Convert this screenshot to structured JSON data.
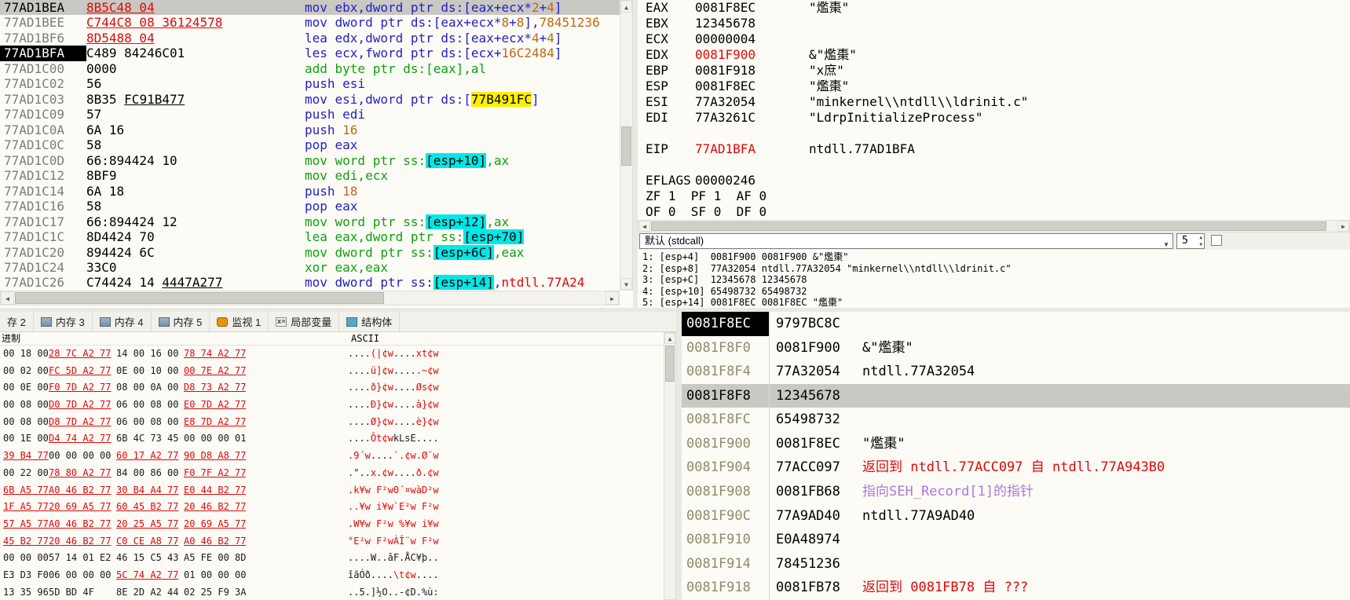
{
  "colors": {
    "accent_red": "#DC0A0A",
    "accent_green": "#0FA00F",
    "accent_blue": "#2121C8",
    "accent_orange": "#C06818",
    "highlight_cyan": "#00E8E8",
    "highlight_yellow": "#FFF000",
    "seh_purple": "#AA78DC",
    "selection_gray": "#C9C8C2"
  },
  "disasm": {
    "rows": [
      {
        "addr": "77AD1BEA",
        "sel": true,
        "bytes": [
          [
            "8B5C48 04",
            "rd ul"
          ]
        ],
        "ins": [
          [
            "mov ebx,dword ptr ds:[eax+ecx*",
            "mb"
          ],
          [
            "2",
            "or"
          ],
          [
            "+",
            "mb"
          ],
          [
            "4",
            "or"
          ],
          [
            "]",
            "mb"
          ]
        ]
      },
      {
        "addr": "77AD1BEE",
        "bytes": [
          [
            "C744C8 08 36124578",
            "rd ul"
          ]
        ],
        "ins": [
          [
            "mov dword ptr ds:[eax+ecx*",
            "mb"
          ],
          [
            "8",
            "or"
          ],
          [
            "+",
            "mb"
          ],
          [
            "8",
            "or"
          ],
          [
            "],",
            "mb"
          ],
          [
            "78451236",
            "or"
          ]
        ]
      },
      {
        "addr": "77AD1BF6",
        "bytes": [
          [
            "8D5488 04",
            "rd ul"
          ]
        ],
        "ins": [
          [
            "lea edx,dword ptr ds:[eax+ecx*",
            "mb"
          ],
          [
            "4",
            "or"
          ],
          [
            "+",
            "mb"
          ],
          [
            "4",
            "or"
          ],
          [
            "]",
            "mb"
          ]
        ]
      },
      {
        "addr": "77AD1BFA",
        "eip": true,
        "bytes": [
          [
            "C489 84246C01",
            "k"
          ]
        ],
        "ins": [
          [
            "les ecx,fword ptr ds:[ecx+",
            "mb"
          ],
          [
            "16C2484",
            "or"
          ],
          [
            "]",
            "mb"
          ]
        ]
      },
      {
        "addr": "77AD1C00",
        "bytes": [
          [
            "0000",
            "k"
          ]
        ],
        "ins": [
          [
            "add byte ptr ds:[eax],al",
            "gr"
          ]
        ]
      },
      {
        "addr": "77AD1C02",
        "bytes": [
          [
            "56",
            "k"
          ]
        ],
        "ins": [
          [
            "push esi",
            "mb"
          ]
        ]
      },
      {
        "addr": "77AD1C03",
        "bytes": [
          [
            "8B35 ",
            "k"
          ],
          [
            "FC91B477",
            "k ul"
          ]
        ],
        "ins": [
          [
            "mov esi,dword ptr ds:[",
            "mb"
          ],
          [
            "77B491FC",
            "hy"
          ],
          [
            "]",
            "mb"
          ]
        ]
      },
      {
        "addr": "77AD1C09",
        "bytes": [
          [
            "57",
            "k"
          ]
        ],
        "ins": [
          [
            "push edi",
            "mb"
          ]
        ]
      },
      {
        "addr": "77AD1C0A",
        "bytes": [
          [
            "6A 16",
            "k"
          ]
        ],
        "ins": [
          [
            "push ",
            "mb"
          ],
          [
            "16",
            "or"
          ]
        ]
      },
      {
        "addr": "77AD1C0C",
        "bytes": [
          [
            "58",
            "k"
          ]
        ],
        "ins": [
          [
            "pop eax",
            "mb"
          ]
        ]
      },
      {
        "addr": "77AD1C0D",
        "bytes": [
          [
            "66:894424 10",
            "k"
          ]
        ],
        "ins": [
          [
            "mov word ptr ss:",
            "gr"
          ],
          [
            "[esp+10]",
            "hc"
          ],
          [
            ",ax",
            "gr"
          ]
        ]
      },
      {
        "addr": "77AD1C12",
        "bytes": [
          [
            "8BF9",
            "k"
          ]
        ],
        "ins": [
          [
            "mov edi,ecx",
            "gr"
          ]
        ]
      },
      {
        "addr": "77AD1C14",
        "bytes": [
          [
            "6A 18",
            "k"
          ]
        ],
        "ins": [
          [
            "push ",
            "mb"
          ],
          [
            "18",
            "or"
          ]
        ]
      },
      {
        "addr": "77AD1C16",
        "bytes": [
          [
            "58",
            "k"
          ]
        ],
        "ins": [
          [
            "pop eax",
            "mb"
          ]
        ]
      },
      {
        "addr": "77AD1C17",
        "bytes": [
          [
            "66:894424 12",
            "k"
          ]
        ],
        "ins": [
          [
            "mov word ptr ss:",
            "gr"
          ],
          [
            "[esp+12]",
            "hc"
          ],
          [
            ",ax",
            "gr"
          ]
        ]
      },
      {
        "addr": "77AD1C1C",
        "bytes": [
          [
            "8D4424 70",
            "k"
          ]
        ],
        "ins": [
          [
            "lea eax,dword ptr ss:",
            "gr"
          ],
          [
            "[esp+70]",
            "hc"
          ]
        ]
      },
      {
        "addr": "77AD1C20",
        "bytes": [
          [
            "894424 6C",
            "k"
          ]
        ],
        "ins": [
          [
            "mov dword ptr ss:",
            "gr"
          ],
          [
            "[esp+6C]",
            "hc"
          ],
          [
            ",eax",
            "gr"
          ]
        ]
      },
      {
        "addr": "77AD1C24",
        "bytes": [
          [
            "33C0",
            "k"
          ]
        ],
        "ins": [
          [
            "xor eax,eax",
            "gr"
          ]
        ]
      },
      {
        "addr": "77AD1C26",
        "bytes": [
          [
            "C74424 14 ",
            "k"
          ],
          [
            "4447A277",
            "k ul"
          ]
        ],
        "ins": [
          [
            "mov dword ptr ss:",
            "mb"
          ],
          [
            "[esp+14]",
            "hc"
          ],
          [
            ",",
            "mb"
          ],
          [
            "ntdll.77A24",
            "rd"
          ]
        ]
      }
    ]
  },
  "registers": {
    "rows": [
      {
        "n": "EAX",
        "v": "0081F8EC",
        "x": "\"爁棗\""
      },
      {
        "n": "EBX",
        "v": "12345678",
        "x": ""
      },
      {
        "n": "ECX",
        "v": "00000004",
        "x": ""
      },
      {
        "n": "EDX",
        "v": "0081F900",
        "vc": "rd",
        "x": "&\"爁棗\""
      },
      {
        "n": "EBP",
        "v": "0081F918",
        "x": "\"x庶\""
      },
      {
        "n": "ESP",
        "v": "0081F8EC",
        "x": "\"爁棗\""
      },
      {
        "n": "ESI",
        "v": "77A32054",
        "x": "\"minkernel\\\\ntdll\\\\ldrinit.c\""
      },
      {
        "n": "EDI",
        "v": "77A3261C",
        "x": "\"LdrpInitializeProcess\""
      },
      {
        "n": "",
        "v": "",
        "x": ""
      },
      {
        "n": "EIP",
        "v": "77AD1BFA",
        "vc": "rd",
        "x": "ntdll.77AD1BFA"
      },
      {
        "n": "",
        "v": "",
        "x": ""
      },
      {
        "n": "EFLAGS",
        "v": "00000246",
        "x": ""
      },
      {
        "n": "ZF 1  PF 1  AF 0",
        "v": "",
        "x": ""
      },
      {
        "n": "OF 0  SF 0  DF 0",
        "v": "",
        "x": ""
      }
    ]
  },
  "callconv": {
    "label": "默认 (stdcall)",
    "spin": "5",
    "dropdown_arrow": "▼"
  },
  "args": {
    "lines": [
      "1: [esp+4]  0081F900 0081F900 &\"爁棗\"",
      "2: [esp+8]  77A32054 ntdll.77A32054 \"minkernel\\\\ntdll\\\\ldrinit.c\"",
      "3: [esp+C]  12345678 12345678",
      "4: [esp+10] 65498732 65498732",
      "5: [esp+14] 0081F8EC 0081F8EC \"爁棗\""
    ]
  },
  "tabs": [
    {
      "label": "存 2",
      "icon": ""
    },
    {
      "label": "内存 3",
      "icon": "memory-icon"
    },
    {
      "label": "内存 4",
      "icon": "memory-icon"
    },
    {
      "label": "内存 5",
      "icon": "memory-icon"
    },
    {
      "label": "监视 1",
      "icon": "watch-icon"
    },
    {
      "label": "局部变量",
      "icon": "locals-icon"
    },
    {
      "label": "结构体",
      "icon": "struct-icon"
    }
  ],
  "dump": {
    "header_left": "进制",
    "header_ascii": "ASCII",
    "rows": [
      {
        "hex": [
          [
            "00 18 00",
            "k"
          ],
          [
            "28 7C A2 77",
            "rd hexul"
          ],
          [
            "14 00 16 00",
            "k"
          ],
          [
            "78 74 A2 77",
            "rd hexul"
          ]
        ],
        "ascii": [
          [
            "....",
            "k"
          ],
          [
            "(|¢w",
            "rd"
          ],
          [
            "....",
            "k"
          ],
          [
            "xt¢w",
            "rd"
          ]
        ]
      },
      {
        "hex": [
          [
            "00 02 00",
            "k"
          ],
          [
            "FC 5D A2 77",
            "rd hexul"
          ],
          [
            "0E 00 10 00",
            "k"
          ],
          [
            "00 7E A2 77",
            "rd hexul"
          ]
        ],
        "ascii": [
          [
            "....",
            "k"
          ],
          [
            "ü]¢w",
            "rd"
          ],
          [
            "....",
            "k"
          ],
          [
            ".~¢w",
            "rd"
          ]
        ]
      },
      {
        "hex": [
          [
            "00 0E 00",
            "k"
          ],
          [
            "F0 7D A2 77",
            "rd hexul"
          ],
          [
            "08 00 0A 00",
            "k"
          ],
          [
            "D8 73 A2 77",
            "rd hexul"
          ]
        ],
        "ascii": [
          [
            "....",
            "k"
          ],
          [
            "ð}¢w",
            "rd"
          ],
          [
            "....",
            "k"
          ],
          [
            "Øs¢w",
            "rd"
          ]
        ]
      },
      {
        "hex": [
          [
            "00 08 00",
            "k"
          ],
          [
            "D0 7D A2 77",
            "rd hexul"
          ],
          [
            "06 00 08 00",
            "k"
          ],
          [
            "E0 7D A2 77",
            "rd hexul"
          ]
        ],
        "ascii": [
          [
            "....",
            "k"
          ],
          [
            "Ð}¢w",
            "rd"
          ],
          [
            "....",
            "k"
          ],
          [
            "à}¢w",
            "rd"
          ]
        ]
      },
      {
        "hex": [
          [
            "00 08 00",
            "k"
          ],
          [
            "D8 7D A2 77",
            "rd hexul"
          ],
          [
            "06 00 08 00",
            "k"
          ],
          [
            "E8 7D A2 77",
            "rd hexul"
          ]
        ],
        "ascii": [
          [
            "....",
            "k"
          ],
          [
            "Ø}¢w",
            "rd"
          ],
          [
            "....",
            "k"
          ],
          [
            "è}¢w",
            "rd"
          ]
        ]
      },
      {
        "hex": [
          [
            "00 1E 00",
            "k"
          ],
          [
            "D4 74 A2 77",
            "rd hexul"
          ],
          [
            "6B 4C 73 45",
            "k"
          ],
          [
            "00 00 00 01",
            "k"
          ]
        ],
        "ascii": [
          [
            "....",
            "k"
          ],
          [
            "Ôt¢w",
            "rd"
          ],
          [
            "kLsE",
            "k"
          ],
          [
            "....",
            "k"
          ]
        ]
      },
      {
        "hex": [
          [
            "39 B4 77",
            "rd hexul"
          ],
          [
            "00 00 00 00",
            "k"
          ],
          [
            "60 17 A2 77",
            "rd hexul"
          ],
          [
            "90 D8 A8 77",
            "rd hexul"
          ]
        ],
        "ascii": [
          [
            ".9´w",
            "rd"
          ],
          [
            "....",
            "k"
          ],
          [
            "`.¢w",
            "rd"
          ],
          [
            ".Ø¨w",
            "rd"
          ]
        ]
      },
      {
        "hex": [
          [
            "00 22 00",
            "k"
          ],
          [
            "78 80 A2 77",
            "rd hexul"
          ],
          [
            "84 00 86 00",
            "k"
          ],
          [
            "F0 7F A2 77",
            "rd hexul"
          ]
        ],
        "ascii": [
          [
            ".\"..",
            "k"
          ],
          [
            "x.¢w",
            "rd"
          ],
          [
            "....",
            "k"
          ],
          [
            "ð.¢w",
            "rd"
          ]
        ]
      },
      {
        "hex": [
          [
            "6B A5 77",
            "rd hexul"
          ],
          [
            "A0 46 B2 77",
            "rd hexul"
          ],
          [
            "30 B4 A4 77",
            "rd hexul"
          ],
          [
            "E0 44 B2 77",
            "rd hexul"
          ]
        ],
        "ascii": [
          [
            ".k¥w",
            "rd"
          ],
          [
            " F²w",
            "rd"
          ],
          [
            "0´¤w",
            "rd"
          ],
          [
            "àD²w",
            "rd"
          ]
        ]
      },
      {
        "hex": [
          [
            "1F A5 77",
            "rd hexul"
          ],
          [
            "20 69 A5 77",
            "rd hexul"
          ],
          [
            "60 45 B2 77",
            "rd hexul"
          ],
          [
            "20 46 B2 77",
            "rd hexul"
          ]
        ],
        "ascii": [
          [
            "..¥w",
            "rd"
          ],
          [
            " i¥w",
            "rd"
          ],
          [
            "`E²w",
            "rd"
          ],
          [
            " F²w",
            "rd"
          ]
        ]
      },
      {
        "hex": [
          [
            "57 A5 77",
            "rd hexul"
          ],
          [
            "A0 46 B2 77",
            "rd hexul"
          ],
          [
            "20 25 A5 77",
            "rd hexul"
          ],
          [
            "20 69 A5 77",
            "rd hexul"
          ]
        ],
        "ascii": [
          [
            ".W¥w",
            "rd"
          ],
          [
            " F²w",
            "rd"
          ],
          [
            " %¥w",
            "rd"
          ],
          [
            " i¥w",
            "rd"
          ]
        ]
      },
      {
        "hex": [
          [
            "45 B2 77",
            "rd hexul"
          ],
          [
            "20 46 B2 77",
            "rd hexul"
          ],
          [
            "C0 CE A8 77",
            "rd hexul"
          ],
          [
            "A0 46 B2 77",
            "rd hexul"
          ]
        ],
        "ascii": [
          [
            "°E²w",
            "rd"
          ],
          [
            " F²w",
            "rd"
          ],
          [
            "ÀÎ¨w",
            "rd"
          ],
          [
            " F²w",
            "rd"
          ]
        ]
      },
      {
        "hex": [
          [
            "00 00 00",
            "k"
          ],
          [
            "57 14 01 E2",
            "k"
          ],
          [
            "46 15 C5 43",
            "k"
          ],
          [
            "A5 FE 00 8D",
            "k"
          ]
        ],
        "ascii": [
          [
            "....",
            "k"
          ],
          [
            "W..â",
            "k"
          ],
          [
            "F.ÅC",
            "k"
          ],
          [
            "¥þ..",
            "k"
          ]
        ]
      },
      {
        "hex": [
          [
            "E3 D3 F0",
            "k"
          ],
          [
            "06 00 00 00",
            "k"
          ],
          [
            "5C 74 A2 77",
            "rd hexul"
          ],
          [
            "01 00 00 00",
            "k"
          ]
        ],
        "ascii": [
          [
            "îãÓð",
            "k"
          ],
          [
            "....",
            "k"
          ],
          [
            "\\t¢w",
            "rd"
          ],
          [
            "....",
            "k"
          ]
        ]
      },
      {
        "hex": [
          [
            "13 35 96",
            "k"
          ],
          [
            "5D BD 4F",
            "k"
          ],
          [
            "8E 2D A2 44",
            "k"
          ],
          [
            "02 25 F9 3A",
            "k"
          ]
        ],
        "ascii": [
          [
            "..5.",
            "k"
          ],
          [
            "]½O.",
            "k"
          ],
          [
            ".-¢D",
            "k"
          ],
          [
            ".%ù:",
            "k"
          ]
        ]
      }
    ]
  },
  "stack": {
    "rows": [
      {
        "a": "0081F8EC",
        "ac": "csp",
        "v": "9797BC8C",
        "c": "",
        "cc": ""
      },
      {
        "a": "0081F8F0",
        "v": "0081F900",
        "c": "&\"爁棗\"",
        "cc": ""
      },
      {
        "a": "0081F8F4",
        "v": "77A32054",
        "c": "ntdll.77A32054",
        "cc": ""
      },
      {
        "a": "0081F8F8",
        "v": "12345678",
        "c": "",
        "cc": "",
        "sel": true
      },
      {
        "a": "0081F8FC",
        "v": "65498732",
        "c": "",
        "cc": ""
      },
      {
        "a": "0081F900",
        "v": "0081F8EC",
        "c": "\"爁棗\"",
        "cc": ""
      },
      {
        "a": "0081F904",
        "v": "77ACC097",
        "c": "返回到 ntdll.77ACC097 自 ntdll.77A943B0",
        "cc": "rd"
      },
      {
        "a": "0081F908",
        "v": "0081FB68",
        "c": "指向SEH_Record[1]的指针",
        "cc": "seh"
      },
      {
        "a": "0081F90C",
        "v": "77A9AD40",
        "c": "ntdll.77A9AD40",
        "cc": ""
      },
      {
        "a": "0081F910",
        "v": "E0A48974",
        "c": "",
        "cc": ""
      },
      {
        "a": "0081F914",
        "v": "78451236",
        "c": "",
        "cc": ""
      },
      {
        "a": "0081F918",
        "v": "0081FB78",
        "c": "返回到 0081FB78 自 ???",
        "cc": "rd"
      }
    ]
  },
  "scroll": {
    "left_arrow": "◀",
    "right_arrow": "▶",
    "up_arrow": "▲",
    "down_arrow": "▼",
    "spin_up": "▲",
    "spin_down": "▼"
  }
}
